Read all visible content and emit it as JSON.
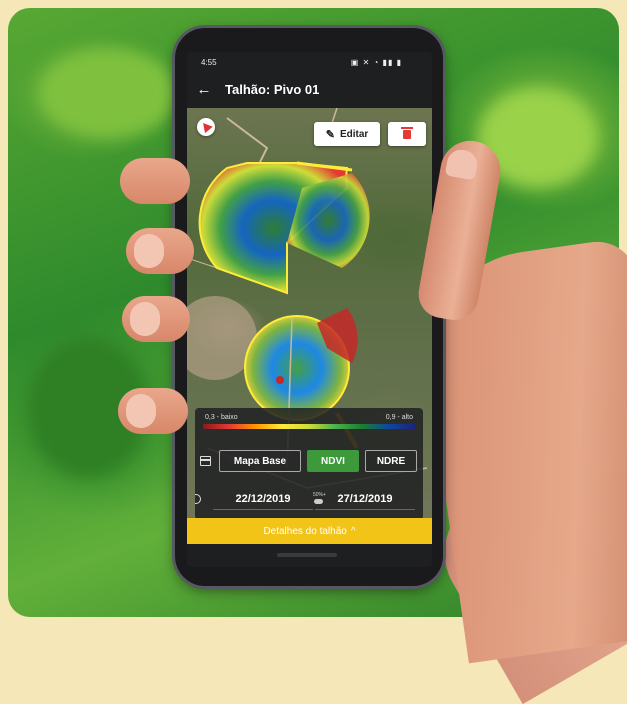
{
  "status_bar": {
    "time": "4:55",
    "icons": "▣ ✕ ◔ ▮▮ ▮"
  },
  "app_bar": {
    "title": "Talhão: Pivo 01"
  },
  "map": {
    "edit_label": "Editar",
    "legend": {
      "low_label": "0,3 - baixo",
      "high_label": "0,9 - alto"
    }
  },
  "layers": {
    "base_label": "Mapa Base",
    "ndvi_label": "NDVI",
    "ndre_label": "NDRE",
    "active": "NDVI"
  },
  "dates": {
    "start": "22/12/2019",
    "end": "27/12/2019",
    "cloud_pct": "50%+"
  },
  "details_button": {
    "label": "Detalhes do talhão",
    "chevron": "^"
  },
  "colors": {
    "accent_yellow": "#f2c418",
    "active_tab": "#3d9a3a",
    "delete_red": "#e53935"
  }
}
